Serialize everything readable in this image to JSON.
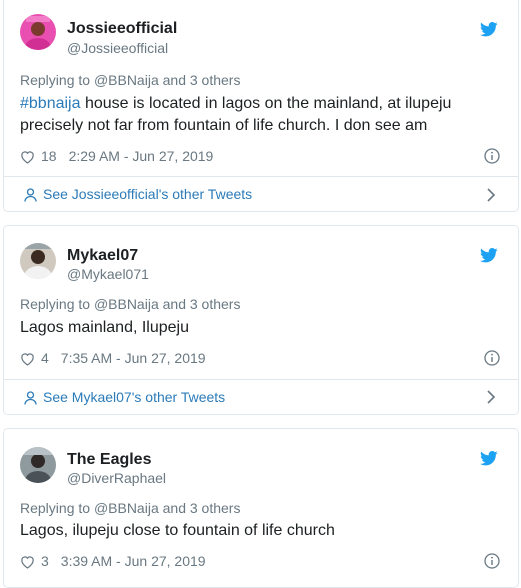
{
  "tweets": [
    {
      "name": "Jossieeofficial",
      "handle": "@Jossieeofficial",
      "replying_prefix": "Replying to ",
      "replying_mention": "@BBNaija",
      "replying_suffix": " and 3 others",
      "hashtag": "#bbnaija",
      "text": " house is located in lagos on the mainland, at ilupeju precisely not far from fountain of life church. I don see am",
      "likes": "18",
      "timestamp": "2:29 AM - Jun 27, 2019",
      "see_more": "See Jossieeofficial's other Tweets"
    },
    {
      "name": "Mykael07",
      "handle": "@Mykael071",
      "replying_prefix": "Replying to ",
      "replying_mention": "@BBNaija",
      "replying_suffix": " and 3 others",
      "text": "Lagos mainland, Ilupeju",
      "likes": "4",
      "timestamp": "7:35 AM - Jun 27, 2019",
      "see_more": "See Mykael07's other Tweets"
    },
    {
      "name": "The Eagles",
      "handle": "@DiverRaphael",
      "replying_prefix": "Replying to ",
      "replying_mention": "@BBNaija",
      "replying_suffix": " and 3 others",
      "text": "Lagos, ilupeju close to fountain of life church",
      "likes": "3",
      "timestamp": "3:39 AM - Jun 27, 2019"
    }
  ],
  "colors": {
    "link": "#2b7bb9",
    "twitter_blue": "#1da1f2",
    "muted": "#697882",
    "border": "#e1e8ed"
  },
  "icons": [
    "twitter-bird-icon",
    "heart-icon",
    "info-icon",
    "person-icon",
    "chevron-right-icon"
  ]
}
